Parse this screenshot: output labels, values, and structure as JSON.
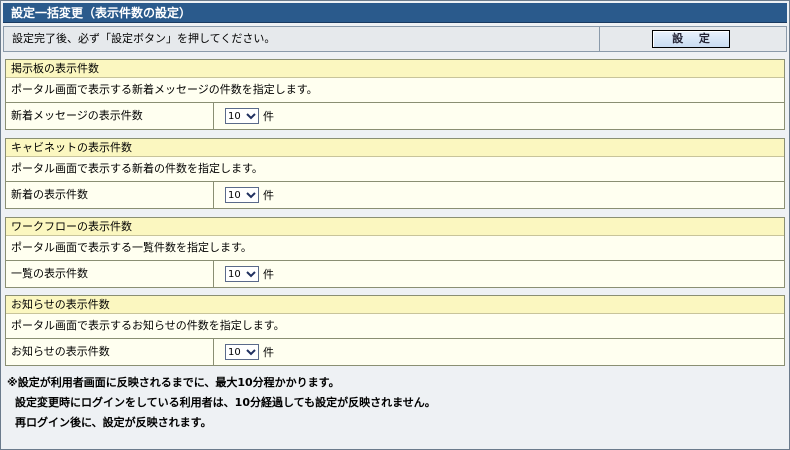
{
  "title": "設定一括変更（表示件数の設定）",
  "notice": {
    "text": "設定完了後、必ず「設定ボタン」を押してください。",
    "button_label": "設 定"
  },
  "sections": [
    {
      "header": "掲示板の表示件数",
      "description": "ポータル画面で表示する新着メッセージの件数を指定します。",
      "label": "新着メッセージの表示件数",
      "value": "10",
      "unit": "件"
    },
    {
      "header": "キャビネットの表示件数",
      "description": "ポータル画面で表示する新着の件数を指定します。",
      "label": "新着の表示件数",
      "value": "10",
      "unit": "件"
    },
    {
      "header": "ワークフローの表示件数",
      "description": "ポータル画面で表示する一覧件数を指定します。",
      "label": "一覧の表示件数",
      "value": "10",
      "unit": "件"
    },
    {
      "header": "お知らせの表示件数",
      "description": "ポータル画面で表示するお知らせの件数を指定します。",
      "label": "お知らせの表示件数",
      "value": "10",
      "unit": "件"
    }
  ],
  "footer": [
    "※設定が利用者画面に反映されるまでに、最大10分程かかります。",
    "設定変更時にログインをしている利用者は、10分経過しても設定が反映されません。",
    "再ログイン後に、設定が反映されます。"
  ],
  "colors": {
    "title_bar": "#2a5a8c",
    "section_header": "#fbf7c0",
    "section_body": "#fffff0"
  },
  "icons": {
    "select_arrow": "chevron-down-icon"
  }
}
